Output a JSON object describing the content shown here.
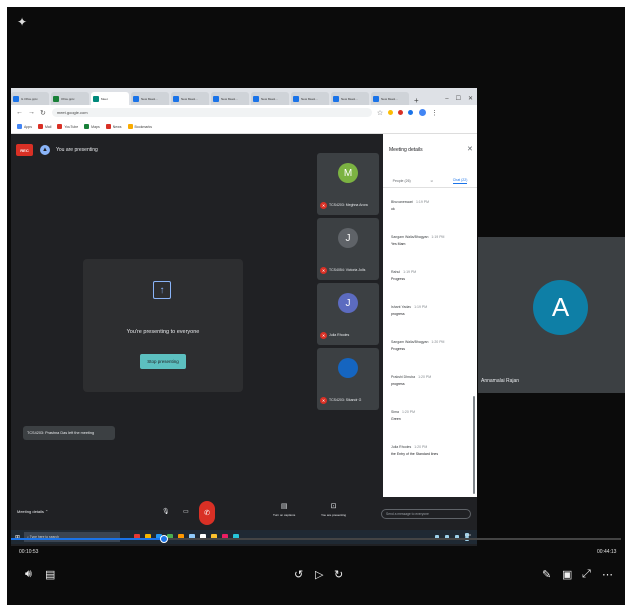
{
  "browser": {
    "tabs": [
      {
        "label": "G Ofice.pptx",
        "color": "#1a73e8",
        "active": false
      },
      {
        "label": "Ofice.pptx",
        "color": "#188038",
        "active": false
      },
      {
        "label": "Meet",
        "color": "#00897b",
        "active": true
      },
      {
        "label": "New Meeti...",
        "color": "#1a73e8",
        "active": false
      },
      {
        "label": "New Meeti...",
        "color": "#1a73e8",
        "active": false
      },
      {
        "label": "New Meeti...",
        "color": "#1a73e8",
        "active": false
      },
      {
        "label": "New Meeti...",
        "color": "#1a73e8",
        "active": false
      },
      {
        "label": "New Meeti...",
        "color": "#1a73e8",
        "active": false
      },
      {
        "label": "New Meeti...",
        "color": "#1a73e8",
        "active": false
      },
      {
        "label": "New Meeti...",
        "color": "#1a73e8",
        "active": false
      }
    ],
    "url": "meet.google.com",
    "bookmarks": [
      {
        "label": "Apps",
        "color": "#4285f4"
      },
      {
        "label": "Mail",
        "color": "#d93025"
      },
      {
        "label": "YouTube",
        "color": "#d93025"
      },
      {
        "label": "Maps",
        "color": "#188038"
      },
      {
        "label": "News",
        "color": "#d93025"
      },
      {
        "label": "Bookmarks",
        "color": "#f9ab00"
      }
    ]
  },
  "meet": {
    "rec_label": "REC",
    "presenting_banner": "You are presenting",
    "present_message": "You're presenting to everyone",
    "stop_button": "Stop presenting",
    "notification": "TCS4203: Prashna Das left the meeting",
    "tiles": [
      {
        "initial": "M",
        "name": "TCS4203: Meghna Arora",
        "color": "#7cb342"
      },
      {
        "initial": "J",
        "name": "TCS4054: Victoria Jolls",
        "color": "#5f6368"
      },
      {
        "initial": "J",
        "name": "Julia Rhodes",
        "color": "#5c6bc0"
      },
      {
        "initial": "",
        "name": "TCS4203: Sikandr G",
        "color": "#1565c0"
      }
    ],
    "panel": {
      "title": "Meeting details",
      "close": "✕",
      "tab_people": "People (26)",
      "tab_chat": "Chat (22)",
      "messages": [
        {
          "author": "Bhuvaneswari",
          "time": "1:19 PM",
          "text": "ok"
        },
        {
          "author": "Sangam Walia/Bhagyan",
          "time": "1:19 PM",
          "text": "Yes Mam"
        },
        {
          "author": "Rahul",
          "time": "1:19 PM",
          "text": "Progress"
        },
        {
          "author": "Ishant Yadav",
          "time": "1:19 PM",
          "text": "progress"
        },
        {
          "author": "Sangam Walia/Bhagyan",
          "time": "1:20 PM",
          "text": "Progress"
        },
        {
          "author": "Prakshi Dhruba",
          "time": "1:20 PM",
          "text": "progress"
        },
        {
          "author": "Sima",
          "time": "1:20 PM",
          "text": "Green"
        },
        {
          "author": "Julia Rhodes",
          "time": "1:20 PM",
          "text": "the Entry of the Standard lines"
        }
      ]
    },
    "controls": {
      "meeting_details": "Meeting details",
      "turn_on_captions": "Turn on captions",
      "you_are_presenting": "You are presenting",
      "send_placeholder": "Send a message to everyone"
    }
  },
  "taskbar": {
    "search_placeholder": "Type here to search",
    "time": "1:20 PM",
    "date": "11/18/2020",
    "icons": [
      "#e53935",
      "#f4b400",
      "#2196f3",
      "#4caf50",
      "#ff9800",
      "#90caf9",
      "#ffffff",
      "#fbc02d",
      "#e91e63",
      "#26c6da"
    ]
  },
  "side": {
    "initial": "A",
    "name": "Annamalai Rajan"
  },
  "player": {
    "current_time": "00:10:53",
    "duration": "00:44:13",
    "progress": 0.25
  }
}
